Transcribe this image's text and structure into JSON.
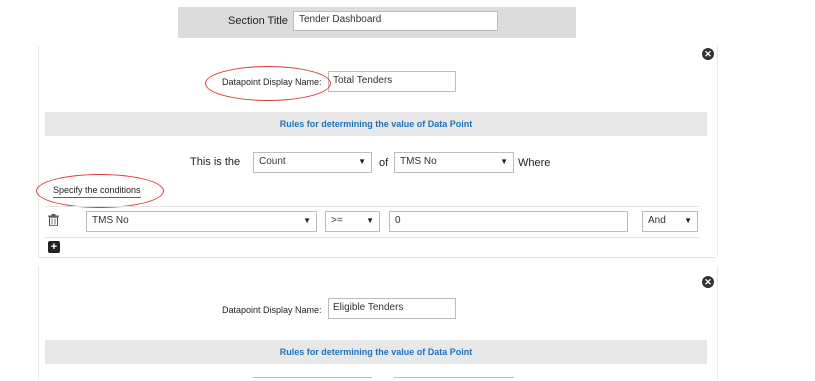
{
  "section": {
    "title_label": "Section Title",
    "title_value": "Tender Dashboard"
  },
  "datapoints": [
    {
      "display_name_label": "Datapoint Display Name:",
      "display_name_value": "Total Tenders",
      "rules_heading": "Rules for determining the value of Data Point",
      "sentence_prefix": "This is the",
      "aggregate": "Count",
      "of_label": "of",
      "field": "TMS No",
      "where_label": "Where",
      "conditions_label": "Specify the conditions",
      "conditions": [
        {
          "field": "TMS No",
          "operator": ">=",
          "value": "0",
          "joiner": "And"
        }
      ]
    },
    {
      "display_name_label": "Datapoint Display Name:",
      "display_name_value": "Eligible Tenders",
      "rules_heading": "Rules for determining the value of Data Point"
    }
  ],
  "icons": {
    "close": "close-icon",
    "trash": "trash-icon",
    "add": "plus-square-icon",
    "resize": "resize-cursor-icon",
    "dropdown": "caret-down-icon"
  },
  "colors": {
    "accent": "#1e73be",
    "annotation": "#d83a3a",
    "title_bar": "#dcdcdc",
    "rules_bar": "#e8e8e8"
  }
}
